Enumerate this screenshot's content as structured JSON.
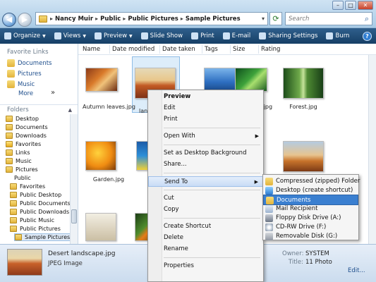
{
  "address": {
    "crumbs": [
      "Nancy Muir",
      "Public",
      "Public Pictures",
      "Sample Pictures"
    ],
    "search_placeholder": "Search"
  },
  "window_controls": {
    "minimize": "–",
    "maximize": "□",
    "close": "✕"
  },
  "toolbar": {
    "items": [
      {
        "label": "Organize",
        "dropdown": true
      },
      {
        "label": "Views",
        "dropdown": true
      },
      {
        "label": "Preview",
        "dropdown": true
      },
      {
        "label": "Slide Show",
        "dropdown": false
      },
      {
        "label": "Print",
        "dropdown": false
      },
      {
        "label": "E-mail",
        "dropdown": false
      },
      {
        "label": "Sharing Settings",
        "dropdown": false
      },
      {
        "label": "Burn",
        "dropdown": false
      }
    ],
    "help": "?"
  },
  "nav": {
    "favorites_header": "Favorite Links",
    "favorites": [
      "Documents",
      "Pictures",
      "Music"
    ],
    "more": "More",
    "more_chev": "»",
    "folders_header": "Folders",
    "tree": [
      "Desktop",
      "Documents",
      "Downloads",
      "Favorites",
      "Links",
      "Music",
      "Pictures",
      "Public",
      "Favorites",
      "Public Desktop",
      "Public Documents",
      "Public Downloads",
      "Public Music",
      "Public Pictures",
      "Sample Pictures"
    ]
  },
  "columns": [
    "Name",
    "Date modified",
    "Date taken",
    "Tags",
    "Size",
    "Rating"
  ],
  "files": {
    "autumn": "Autumn leaves.jpg",
    "desert_partial": "land",
    "creek_partial": "s.jpg",
    "forest": "Forest.jpg",
    "garden": "Garden.jpg"
  },
  "context_menu": {
    "items": [
      "Preview",
      "Edit",
      "Print",
      "Open With",
      "Set as Desktop Background",
      "Share...",
      "Send To",
      "Cut",
      "Copy",
      "Create Shortcut",
      "Delete",
      "Rename",
      "Properties"
    ],
    "submenu_arrow": "▶"
  },
  "send_to": {
    "items": [
      "Compressed (zipped) Folder",
      "Desktop (create shortcut)",
      "Documents",
      "Mail Recipient",
      "Floppy Disk Drive (A:)",
      "CD-RW Drive (F:)",
      "Removable Disk (G:)"
    ]
  },
  "details": {
    "name": "Desert landscape.jpg",
    "type": "JPEG Image",
    "owner_label": "Owner:",
    "owner_value": "SYSTEM",
    "title_label": "Title:",
    "title_value": "11 Photo",
    "edit_link": "Edit..."
  }
}
